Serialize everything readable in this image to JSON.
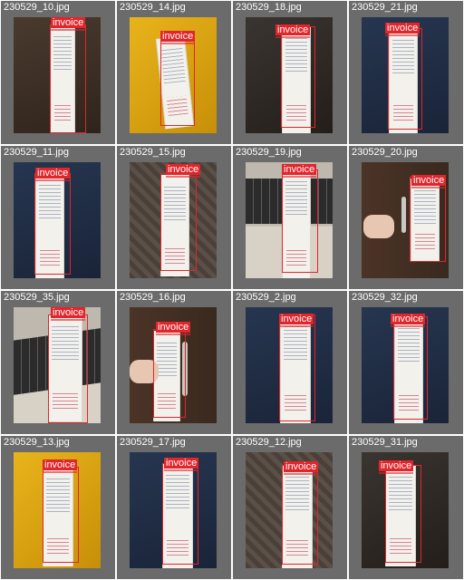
{
  "colors": {
    "label_bg": "#e1252b",
    "tile_bg": "#6b6b6b"
  },
  "tiles": [
    {
      "filename": "230529_10.jpg",
      "label": "invoice",
      "scene": "wood"
    },
    {
      "filename": "230529_14.jpg",
      "label": "invoice",
      "scene": "yellow"
    },
    {
      "filename": "230529_18.jpg",
      "label": "invoice",
      "scene": "dark"
    },
    {
      "filename": "230529_21.jpg",
      "label": "invoice",
      "scene": "blue"
    },
    {
      "filename": "230529_11.jpg",
      "label": "invoice",
      "scene": "blue"
    },
    {
      "filename": "230529_15.jpg",
      "label": "invoice",
      "scene": "weave"
    },
    {
      "filename": "230529_19.jpg",
      "label": "invoice",
      "scene": "keyboard"
    },
    {
      "filename": "230529_20.jpg",
      "label": "invoice",
      "scene": "door"
    },
    {
      "filename": "230529_35.jpg",
      "label": "invoice",
      "scene": "keyboard"
    },
    {
      "filename": "230529_16.jpg",
      "label": "invoice",
      "scene": "door"
    },
    {
      "filename": "230529_2.jpg",
      "label": "invoice",
      "scene": "blue"
    },
    {
      "filename": "230529_32.jpg",
      "label": "invoice",
      "scene": "blue"
    },
    {
      "filename": "230529_13.jpg",
      "label": "invoice",
      "scene": "yellow"
    },
    {
      "filename": "230529_17.jpg",
      "label": "invoice",
      "scene": "blue"
    },
    {
      "filename": "230529_12.jpg",
      "label": "invoice",
      "scene": "weave"
    },
    {
      "filename": "230529_31.jpg",
      "label": "invoice",
      "scene": "dark"
    }
  ]
}
